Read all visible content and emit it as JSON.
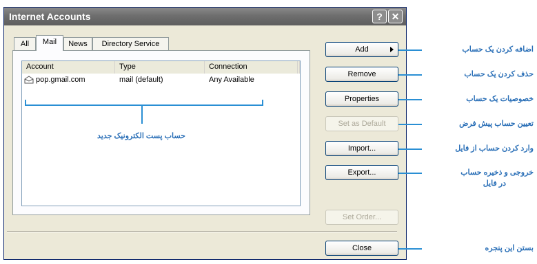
{
  "window": {
    "title": "Internet Accounts",
    "help_button": "?",
    "close_glyph": "X"
  },
  "tabs": [
    {
      "label": "All",
      "active": false
    },
    {
      "label": "Mail",
      "active": true
    },
    {
      "label": "News",
      "active": false
    },
    {
      "label": "Directory Service",
      "active": false
    }
  ],
  "list": {
    "columns": [
      "Account",
      "Type",
      "Connection"
    ],
    "rows": [
      {
        "account": "pop.gmail.com",
        "type": "mail (default)",
        "connection": "Any Available",
        "icon": "mail-account-icon"
      }
    ]
  },
  "buttons": {
    "add": "Add",
    "remove": "Remove",
    "properties": "Properties",
    "set_default": "Set as Default",
    "import": "Import...",
    "export": "Export...",
    "set_order": "Set Order...",
    "close": "Close"
  },
  "annotations": {
    "add": "اضافه کردن یک حساب",
    "remove": "حذف کردن یک حساب",
    "properties": "خصوصیات یک حساب",
    "set_default": "تعیین حساب پیش فرض",
    "import": "وارد کردن حساب از فایل",
    "export_line1": "خروجی و ذخیره حساب",
    "export_line2": "در فایل",
    "close": "بستن این پنجره",
    "new_account": "حساب پست الکترونیک جدید"
  },
  "colors": {
    "annotation": "#2a6fb7",
    "window_title": "#6e6e6e"
  }
}
